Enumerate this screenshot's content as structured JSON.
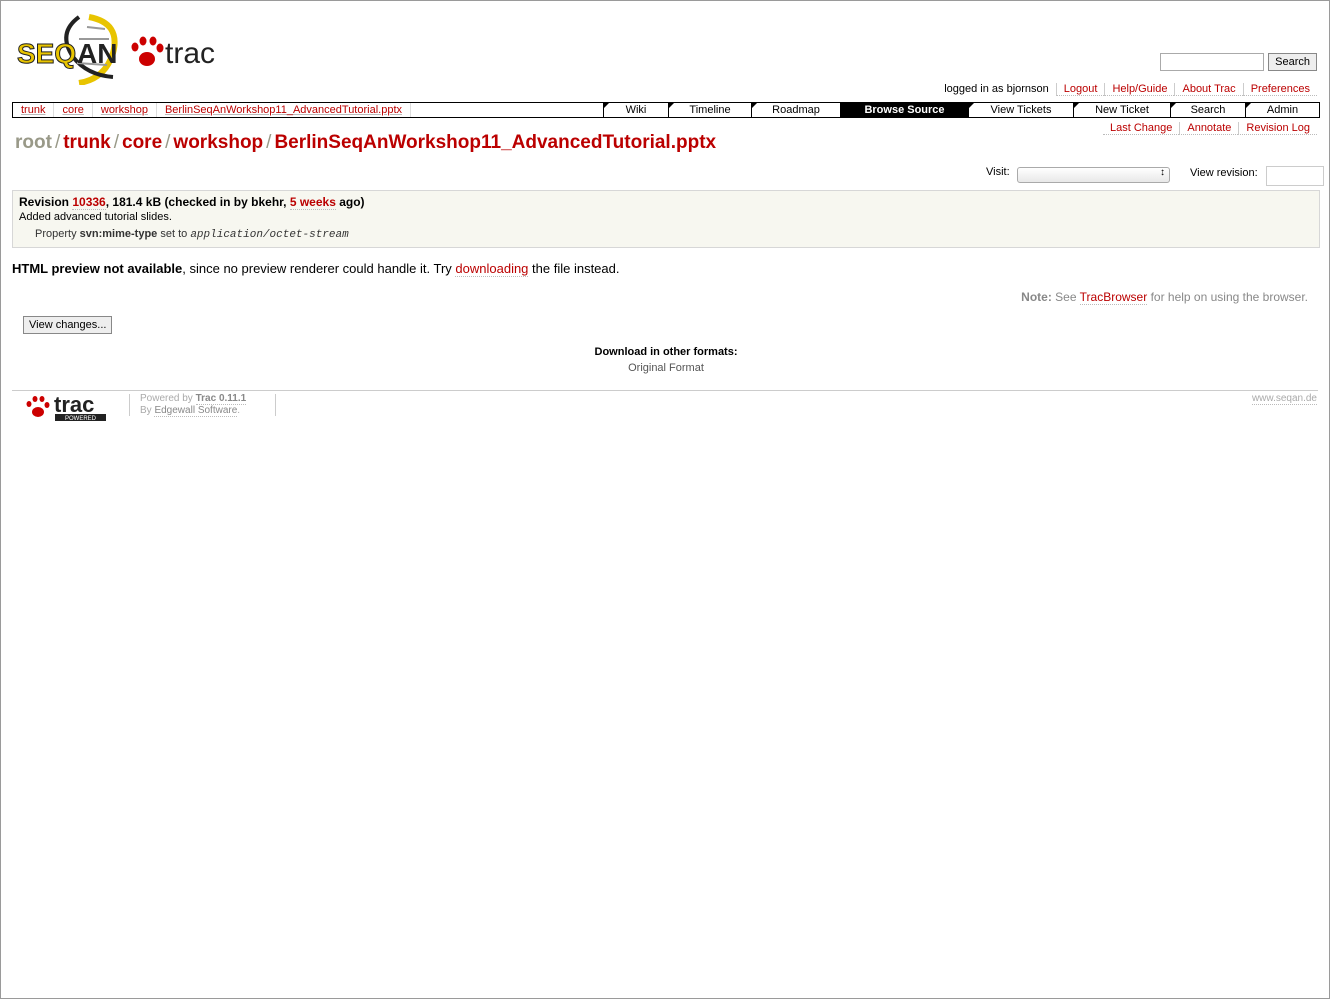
{
  "header": {
    "logo_text_left": "SEQAN",
    "logo_text_right": "trac",
    "search_button": "Search",
    "search_value": ""
  },
  "metanav": [
    "logged in as bjornson",
    "Logout",
    "Help/Guide",
    "About Trac",
    "Preferences"
  ],
  "ctxpath": [
    "trunk",
    "core",
    "workshop",
    "BerlinSeqAnWorkshop11_AdvancedTutorial.pptx"
  ],
  "mainnav": [
    {
      "label": "Wiki",
      "active": false
    },
    {
      "label": "Timeline",
      "active": false
    },
    {
      "label": "Roadmap",
      "active": false
    },
    {
      "label": "Browse Source",
      "active": true
    },
    {
      "label": "View Tickets",
      "active": false
    },
    {
      "label": "New Ticket",
      "active": false
    },
    {
      "label": "Search",
      "active": false
    },
    {
      "label": "Admin",
      "active": false
    }
  ],
  "ctxtnav": [
    "Last Change",
    "Annotate",
    "Revision Log"
  ],
  "path": {
    "root": "root",
    "parts": [
      "trunk",
      "core",
      "workshop",
      "BerlinSeqAnWorkshop11_AdvancedTutorial.pptx"
    ],
    "separator": "/"
  },
  "visit": {
    "label": "Visit:",
    "selected": ""
  },
  "view_revision": {
    "label": "View revision:",
    "value": ""
  },
  "info": {
    "revision_prefix": "Revision ",
    "revision": "10336",
    "size_part": ", 181.4 kB (checked in by bkehr, ",
    "age": "5 weeks",
    "age_suffix": " ago)",
    "message": "Added advanced tutorial slides.",
    "prop_prefix": "Property ",
    "prop_name": "svn:mime-type",
    "prop_mid": " set to ",
    "prop_value": "application/octet-stream"
  },
  "preview": {
    "bold": "HTML preview not available",
    "middle": ", since no preview renderer could handle it. Try ",
    "link": "downloading",
    "end": " the file instead."
  },
  "note": {
    "label": "Note:",
    "pre": " See ",
    "link": "TracBrowser",
    "post": " for help on using the browser."
  },
  "view_changes_button": "View changes...",
  "altlinks": {
    "title": "Download in other formats:",
    "link": "Original Format"
  },
  "footer": {
    "trac_logo_text": "trac",
    "trac_logo_sub": "POWERED",
    "powered_by": "Powered by ",
    "trac_version": "Trac 0.11.1",
    "by": "By ",
    "company": "Edgewall Software",
    "period": ".",
    "site": "www.seqan.de"
  },
  "colors": {
    "link": "#bb0000",
    "active_tab": "#000000",
    "info_bg": "#f7f7f0"
  }
}
